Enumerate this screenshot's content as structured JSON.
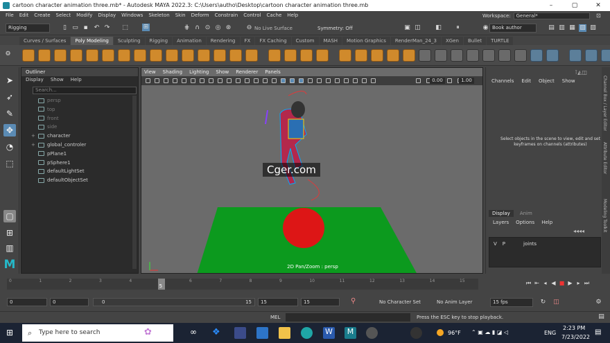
{
  "window": {
    "title": "cartoon character animation three.mb* - Autodesk MAYA 2022.3: C:\\Users\\autho\\Desktop\\cartoon character animation three.mb",
    "minimize": "–",
    "maximize": "▢",
    "close": "✕"
  },
  "menubar": {
    "items": [
      "File",
      "Edit",
      "Create",
      "Select",
      "Modify",
      "Display",
      "Windows",
      "Skeleton",
      "Skin",
      "Deform",
      "Constrain",
      "Control",
      "Cache",
      "Help"
    ],
    "workspace_label": "Workspace:",
    "workspace_value": "General*"
  },
  "status": {
    "mode": "Rigging",
    "live_surface": "No Live Surface",
    "symmetry": "Symmetry: Off",
    "account": "Book author"
  },
  "shelf": {
    "tabs": [
      "Curves / Surfaces",
      "Poly Modeling",
      "Sculpting",
      "Rigging",
      "Animation",
      "Rendering",
      "FX",
      "FX Caching",
      "Custom",
      "MASH",
      "Motion Graphics",
      "RenderMan_24_3",
      "XGen",
      "Bullet",
      "TURTLE"
    ],
    "active_tab": "Poly Modeling"
  },
  "outliner": {
    "title": "Outliner",
    "menu": [
      "Display",
      "Show",
      "Help"
    ],
    "search_placeholder": "Search...",
    "items": [
      {
        "label": "persp",
        "dim": true,
        "expand": ""
      },
      {
        "label": "top",
        "dim": true,
        "expand": ""
      },
      {
        "label": "front",
        "dim": true,
        "expand": ""
      },
      {
        "label": "side",
        "dim": true,
        "expand": ""
      },
      {
        "label": "character",
        "dim": false,
        "expand": "+"
      },
      {
        "label": "global_controler",
        "dim": false,
        "expand": "+"
      },
      {
        "label": "pPlane1",
        "dim": false,
        "expand": ""
      },
      {
        "label": "pSphere1",
        "dim": false,
        "expand": ""
      },
      {
        "label": "defaultLightSet",
        "dim": false,
        "expand": ""
      },
      {
        "label": "defaultObjectSet",
        "dim": false,
        "expand": ""
      }
    ]
  },
  "viewport": {
    "menu": [
      "View",
      "Shading",
      "Lighting",
      "Show",
      "Renderer",
      "Panels"
    ],
    "field1": "0.00",
    "field2": "1.00",
    "camera_label": "2D Pan/Zoom : persp"
  },
  "watermark": "Cger.com",
  "channelbox": {
    "menu": [
      "Channels",
      "Edit",
      "Object",
      "Show"
    ],
    "hint": "Select objects in the scene to view, edit and set keyframes on channels (attributes)",
    "layer_tabs": [
      "Display",
      "Anim"
    ],
    "layer_menu": [
      "Layers",
      "Options",
      "Help"
    ],
    "layer_v": "V",
    "layer_p": "P",
    "layer_name": "joints"
  },
  "sidetabs": [
    "Channel Box / Layer Editor",
    "Attribute Editor",
    "Modeling Toolkit"
  ],
  "timeline": {
    "ticks": [
      "0",
      "1",
      "2",
      "3",
      "4",
      "5",
      "6",
      "7",
      "8",
      "9",
      "10",
      "11",
      "12",
      "13",
      "14",
      "15"
    ],
    "current_frame": "5",
    "start": 0,
    "end": 15,
    "current": 5
  },
  "range": {
    "start": "0",
    "anim_start": "0",
    "range_start": "0",
    "range_end": "15",
    "anim_end": "15",
    "end": "15",
    "character_set": "No Character Set",
    "anim_layer": "No Anim Layer",
    "fps": "15 fps"
  },
  "cmdline": {
    "label": "MEL",
    "message": "Press the ESC key to stop playback."
  },
  "taskbar": {
    "search_placeholder": "Type here to search",
    "weather": "96°F",
    "language": "ENG",
    "time": "2:23 PM",
    "date": "7/23/2022"
  }
}
